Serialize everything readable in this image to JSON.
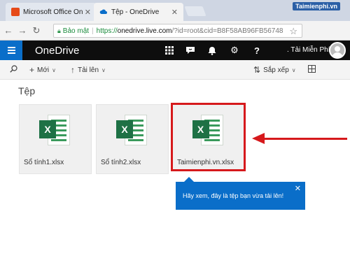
{
  "browser": {
    "tabs": [
      {
        "title": "Microsoft Office Online",
        "favicon": "office-icon",
        "active": false
      },
      {
        "title": "Tệp - OneDrive",
        "favicon": "onedrive-cloud-icon",
        "active": true
      }
    ],
    "brand_watermark": "Taimienphi.vn",
    "address": {
      "security_label": "Bảo mật",
      "scheme": "https://",
      "host": "onedrive.live.com",
      "rest": "/?id=root&cid=B8F58AB96FB56748"
    }
  },
  "onedrive": {
    "brand": "OneDrive",
    "user_name": ". Tải Miễn Phí",
    "header_icons": [
      "app-grid-icon",
      "skype-chat-icon",
      "notification-bell-icon",
      "settings-gear-icon",
      "help-icon"
    ]
  },
  "commands": {
    "new_label": "Mới",
    "upload_label": "Tải lên",
    "sort_label": "Sắp xếp"
  },
  "content": {
    "heading": "Tệp",
    "files": [
      {
        "name": "Sổ tính1.xlsx"
      },
      {
        "name": "Sổ tính2.xlsx"
      },
      {
        "name": "Taimienphi.vn.xlsx"
      }
    ],
    "callout_text": "Hãy xem, đây là tệp bạn vừa tải lên!"
  },
  "colors": {
    "accent": "#0a6ec9",
    "highlight": "#d6191c",
    "excel_green": "#1e7145"
  }
}
